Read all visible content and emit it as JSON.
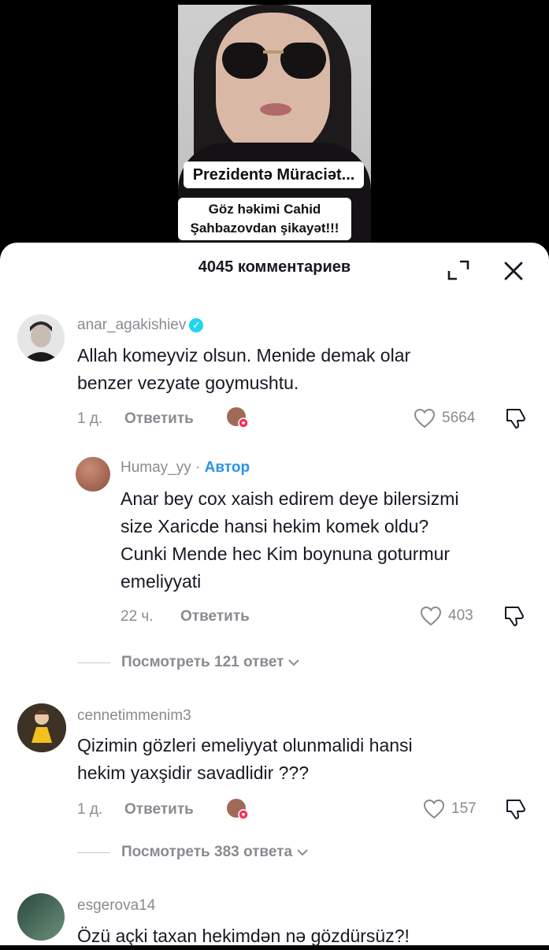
{
  "video": {
    "caption_title": "Prezidentə Müraciət...",
    "caption_sub_line1": "Göz həkimi Cahid",
    "caption_sub_line2": "Şahbazovdan şikayət!!!"
  },
  "sheet": {
    "title": "4045 комментариев",
    "expand_icon": "expand-icon",
    "close_icon": "close-icon"
  },
  "comments": [
    {
      "username": "anar_agakishiev",
      "verified": true,
      "text_line1": "Allah komeyviz olsun. Menide demak olar",
      "text_line2": "benzer vezyate goymushtu.",
      "time": "1 д.",
      "reply_label": "Ответить",
      "likes": "5664"
    },
    {
      "username": "Humay_yy",
      "separator": "·",
      "author_badge": "Автор",
      "text_line1": "Anar bey cox xaish edirem deye bilersizmi",
      "text_line2": "size Xaricde hansi hekim komek oldu?",
      "text_line3": "Cunki Mende hec Kim boynuna goturmur",
      "text_line4": "emeliyyati",
      "time": "22 ч.",
      "reply_label": "Ответить",
      "likes": "403"
    },
    {
      "username": "cennetimmenim3",
      "text_line1": "Qizimin gözleri emeliyyat olunmalidi hansi",
      "text_line2": "hekim yaxşidir savadlidir ???",
      "time": "1 д.",
      "reply_label": "Ответить",
      "likes": "157"
    },
    {
      "username": "esgerova14",
      "text_line1": "Özü açki taxan hekimdən nə gözdürsüz?!"
    }
  ],
  "view_replies": [
    {
      "label": "Посмотреть 121 ответ"
    },
    {
      "label": "Посмотреть 383 ответа"
    }
  ],
  "colors": {
    "verified": "#20d5ec",
    "author": "#2b92e6",
    "like_heart_badge": "#fe2c55",
    "muted_text": "#8a8b91"
  }
}
